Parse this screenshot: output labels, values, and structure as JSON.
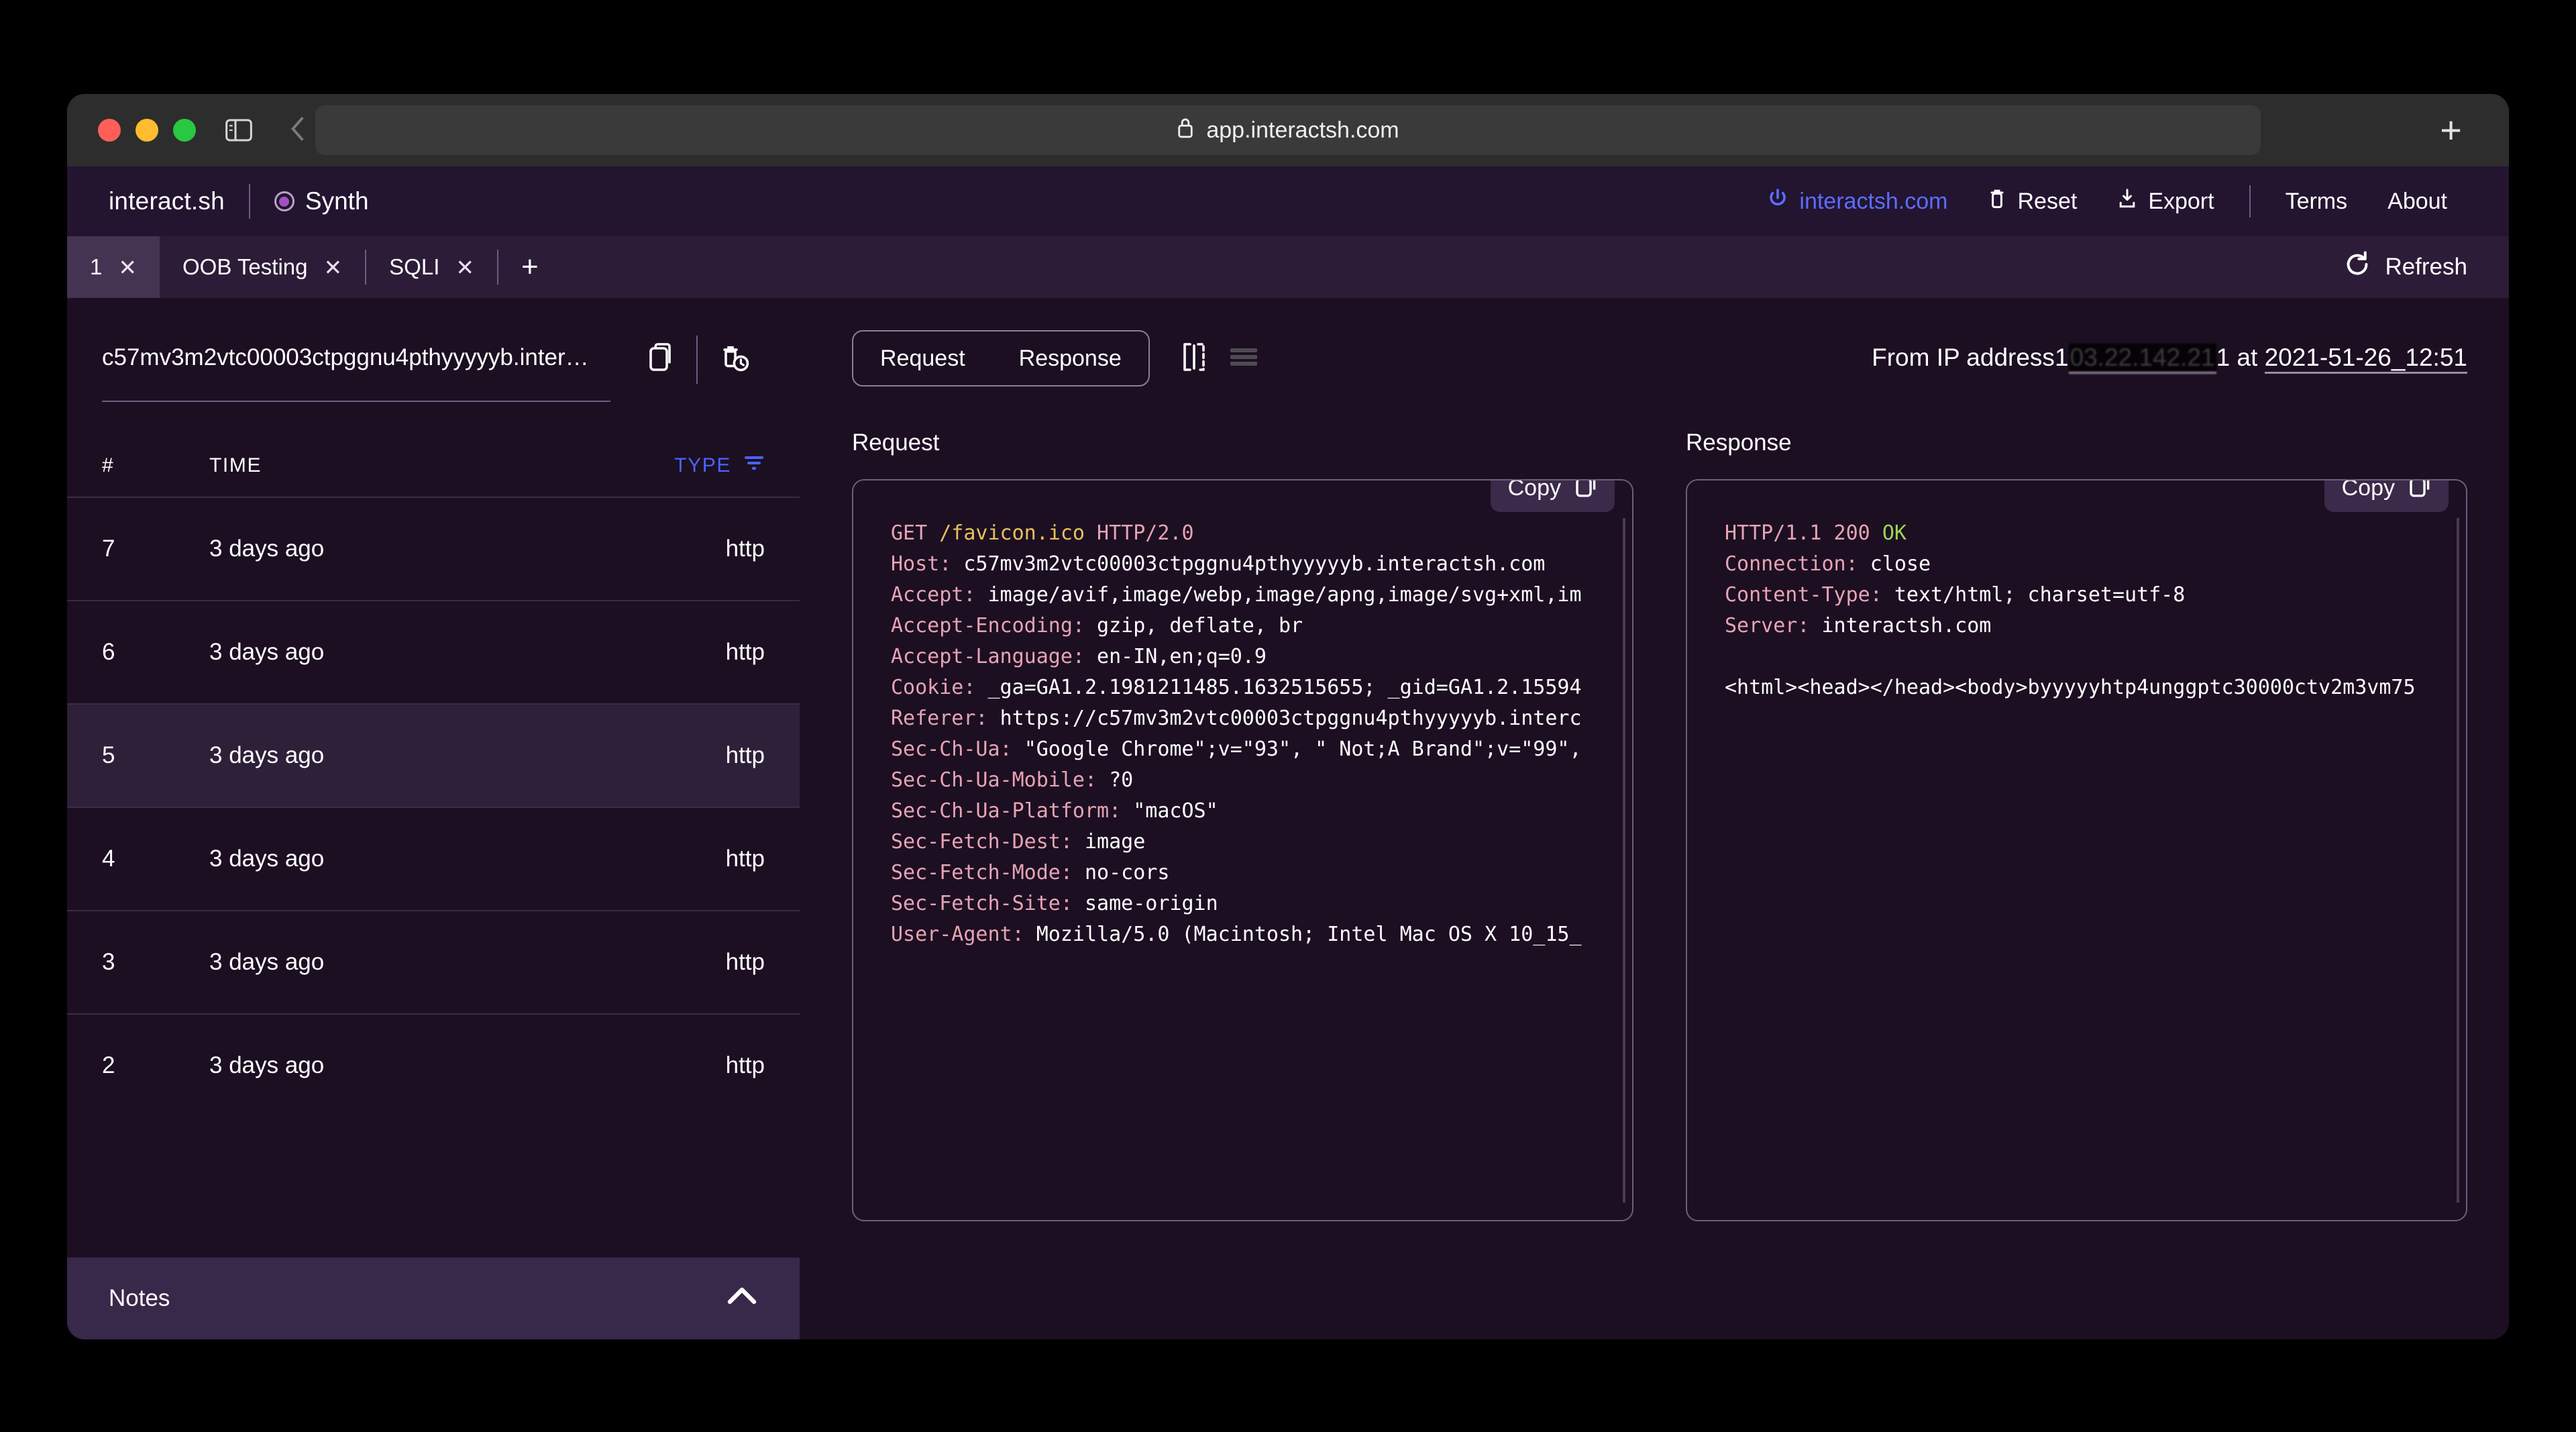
{
  "browser": {
    "url": "app.interactsh.com",
    "lock_icon": "lock-icon",
    "sidebar_icon": "sidebar-toggle-icon",
    "back_icon": "chevron-left-icon",
    "forward_icon": "chevron-right-icon",
    "new_tab": "+"
  },
  "header": {
    "brand": "interact.sh",
    "synth": "Synth",
    "links": {
      "domain": "interactsh.com",
      "reset": "Reset",
      "export": "Export",
      "terms": "Terms",
      "about": "About"
    }
  },
  "tabs": {
    "items": [
      {
        "label": "1",
        "close": "✕",
        "active": true
      },
      {
        "label": "OOB Testing",
        "close": "✕",
        "active": false
      },
      {
        "label": "SQLI",
        "close": "✕",
        "active": false
      }
    ],
    "add": "+",
    "refresh": "Refresh"
  },
  "sidebar": {
    "url": "c57mv3m2vtc00003ctpggnu4pthyyyyyb.inter…",
    "copy_icon": "copy-icon",
    "delete_icon": "trash-clock-icon",
    "columns": {
      "index": "#",
      "time": "TIME",
      "type": "TYPE"
    },
    "rows": [
      {
        "index": "7",
        "time": "3 days ago",
        "type": "http",
        "selected": false
      },
      {
        "index": "6",
        "time": "3 days ago",
        "type": "http",
        "selected": false
      },
      {
        "index": "5",
        "time": "3 days ago",
        "type": "http",
        "selected": true
      },
      {
        "index": "4",
        "time": "3 days ago",
        "type": "http",
        "selected": false
      },
      {
        "index": "3",
        "time": "3 days ago",
        "type": "http",
        "selected": false
      },
      {
        "index": "2",
        "time": "3 days ago",
        "type": "http",
        "selected": false
      }
    ],
    "notes": "Notes"
  },
  "main": {
    "segment": {
      "request": "Request",
      "response": "Response"
    },
    "split_icon": "split-view-icon",
    "list_icon": "list-view-icon",
    "meta": {
      "prefix": "From IP address",
      "ip_visible_start": "1",
      "ip_redacted": "03.22.142.21",
      "ip_visible_end": "1",
      "at": "at",
      "timestamp": "2021-51-26_12:51"
    },
    "request": {
      "title": "Request",
      "copy": "Copy",
      "copy_icon": "copy-icon",
      "lines": [
        {
          "k": "GET ",
          "path": "/favicon.ico",
          "k2": " HTTP/2.0"
        },
        {
          "k": "Host: ",
          "v": "c57mv3m2vtc00003ctpggnu4pthyyyyyb.interactsh.com"
        },
        {
          "k": "Accept: ",
          "v": "image/avif,image/webp,image/apng,image/svg+xml,im"
        },
        {
          "k": "Accept-Encoding: ",
          "v": "gzip, deflate, br"
        },
        {
          "k": "Accept-Language: ",
          "v": "en-IN,en;q=0.9"
        },
        {
          "k": "Cookie: ",
          "v": "_ga=GA1.2.1981211485.1632515655; _gid=GA1.2.15594"
        },
        {
          "k": "Referer: ",
          "v": "https://c57mv3m2vtc00003ctpggnu4pthyyyyyb.interc"
        },
        {
          "k": "Sec-Ch-Ua: ",
          "v": "\"Google Chrome\";v=\"93\", \" Not;A Brand\";v=\"99\","
        },
        {
          "k": "Sec-Ch-Ua-Mobile: ",
          "v": "?0"
        },
        {
          "k": "Sec-Ch-Ua-Platform: ",
          "v": "\"macOS\""
        },
        {
          "k": "Sec-Fetch-Dest: ",
          "v": "image"
        },
        {
          "k": "Sec-Fetch-Mode: ",
          "v": "no-cors"
        },
        {
          "k": "Sec-Fetch-Site: ",
          "v": "same-origin"
        },
        {
          "k": "User-Agent: ",
          "v": "Mozilla/5.0 (Macintosh; Intel Mac OS X 10_15_"
        }
      ]
    },
    "response": {
      "title": "Response",
      "copy": "Copy",
      "copy_icon": "copy-icon",
      "status_prefix": "HTTP/1.1 200 ",
      "status_ok": "OK",
      "lines": [
        {
          "k": "Connection: ",
          "v": "close"
        },
        {
          "k": "Content-Type: ",
          "v": "text/html; charset=utf-8"
        },
        {
          "k": "Server: ",
          "v": "interactsh.com"
        }
      ],
      "body": "<html><head></head><body>byyyyyhtp4unggptc30000ctv2m3vm75"
    }
  }
}
